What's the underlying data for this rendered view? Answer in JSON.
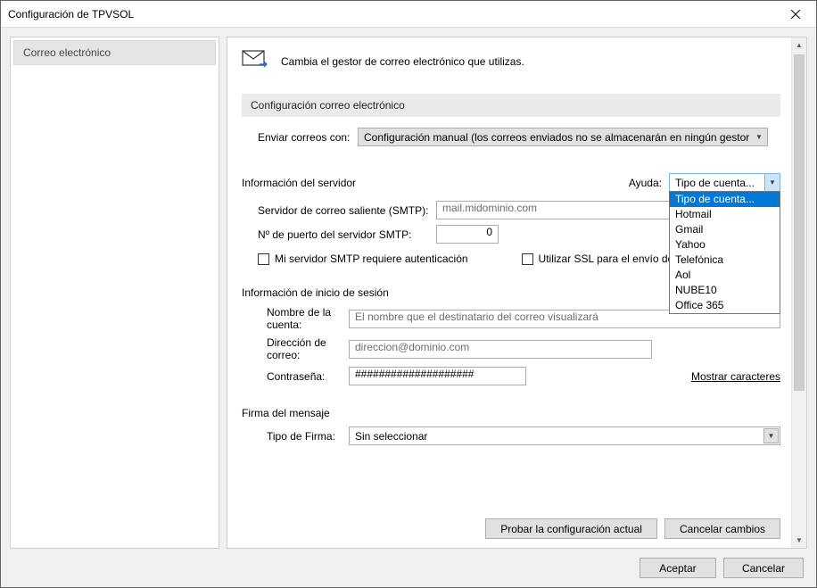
{
  "window": {
    "title": "Configuración de TPVSOL"
  },
  "sidebar": {
    "items": [
      {
        "label": "Correo electrónico"
      }
    ]
  },
  "header": {
    "description": "Cambia el gestor de correo electrónico que utilizas."
  },
  "section_email": {
    "title": "Configuración correo electrónico",
    "send_with_label": "Enviar correos con:",
    "send_with_value": "Configuración manual (los correos enviados no se almacenarán en ningún gestor de correo)"
  },
  "server_info": {
    "title": "Información del servidor",
    "help_label": "Ayuda:",
    "help_combo_value": "Tipo de cuenta...",
    "help_options": [
      "Tipo de cuenta...",
      "Hotmail",
      "Gmail",
      "Yahoo",
      "Telefónica",
      "Aol",
      "NUBE10",
      "Office 365"
    ],
    "smtp_server_label": "Servidor de correo saliente (SMTP):",
    "smtp_server_placeholder": "mail.midominio.com",
    "smtp_port_label": "Nº de puerto del servidor SMTP:",
    "smtp_port_value": "0",
    "auth_checkbox_label": "Mi servidor SMTP requiere autenticación",
    "ssl_checkbox_label": "Utilizar SSL para el envío de correo"
  },
  "login_info": {
    "title": "Información de inicio de sesión",
    "account_name_label": "Nombre de la cuenta:",
    "account_name_placeholder": "El nombre que el destinatario del correo visualizará",
    "email_label": "Dirección de correo:",
    "email_placeholder": "direccion@dominio.com",
    "password_label": "Contraseña:",
    "password_value": "####################",
    "show_chars_link": "Mostrar caracteres"
  },
  "signature": {
    "title": "Firma del mensaje",
    "type_label": "Tipo de Firma:",
    "type_value": "Sin seleccionar"
  },
  "inner_buttons": {
    "test": "Probar la configuración actual",
    "cancel_changes": "Cancelar cambios"
  },
  "footer": {
    "ok": "Aceptar",
    "cancel": "Cancelar"
  }
}
